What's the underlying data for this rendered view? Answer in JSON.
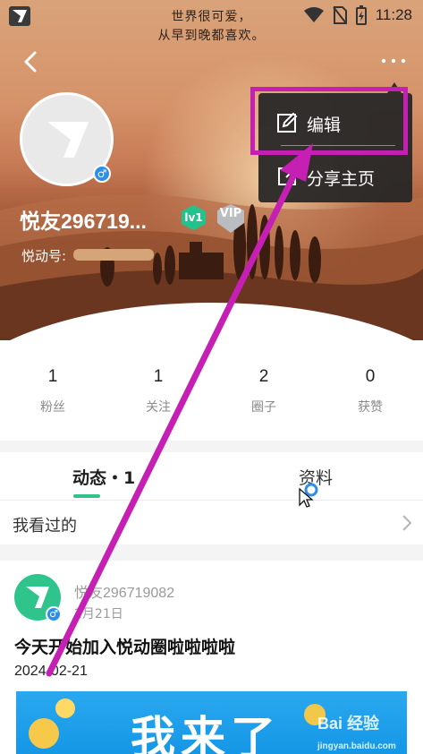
{
  "status_bar": {
    "tagline_line1": "世界很可爱，",
    "tagline_line2": "从早到晚都喜欢。",
    "time": "11:28",
    "icons": [
      "app-logo-icon",
      "wifi-icon",
      "no-sim-icon",
      "battery-charging-icon"
    ]
  },
  "header": {
    "back_icon": "chevron-left-icon",
    "more_icon": "more-dots-icon"
  },
  "profile": {
    "username": "悦友296719...",
    "level_badge": "lv1",
    "vip_badge": "VIP",
    "id_label": "悦动号:",
    "gender": "♂"
  },
  "menu": {
    "items": [
      {
        "label": "编辑",
        "icon": "edit-icon"
      },
      {
        "label": "分享主页",
        "icon": "share-icon"
      }
    ]
  },
  "stats": [
    {
      "value": "1",
      "label": "粉丝"
    },
    {
      "value": "1",
      "label": "关注"
    },
    {
      "value": "2",
      "label": "圈子"
    },
    {
      "value": "0",
      "label": "获赞"
    }
  ],
  "tabs": [
    {
      "label": "动态・1",
      "active": true
    },
    {
      "label": "资料",
      "active": false
    }
  ],
  "viewed": {
    "label": "我看过的"
  },
  "post": {
    "author": "悦友296719082",
    "date": "2月21日",
    "title": "今天开始加入悦动圈啦啦啦啦",
    "text": "2024-02-21",
    "image_text": "我来了",
    "gender": "♂"
  },
  "watermark": {
    "brand": "Bai 经验",
    "url": "jingyan.baidu.com"
  },
  "colors": {
    "accent_green": "#2dc38a",
    "annotation_magenta": "#c51fb4",
    "gender_blue": "#2f8fe6"
  }
}
